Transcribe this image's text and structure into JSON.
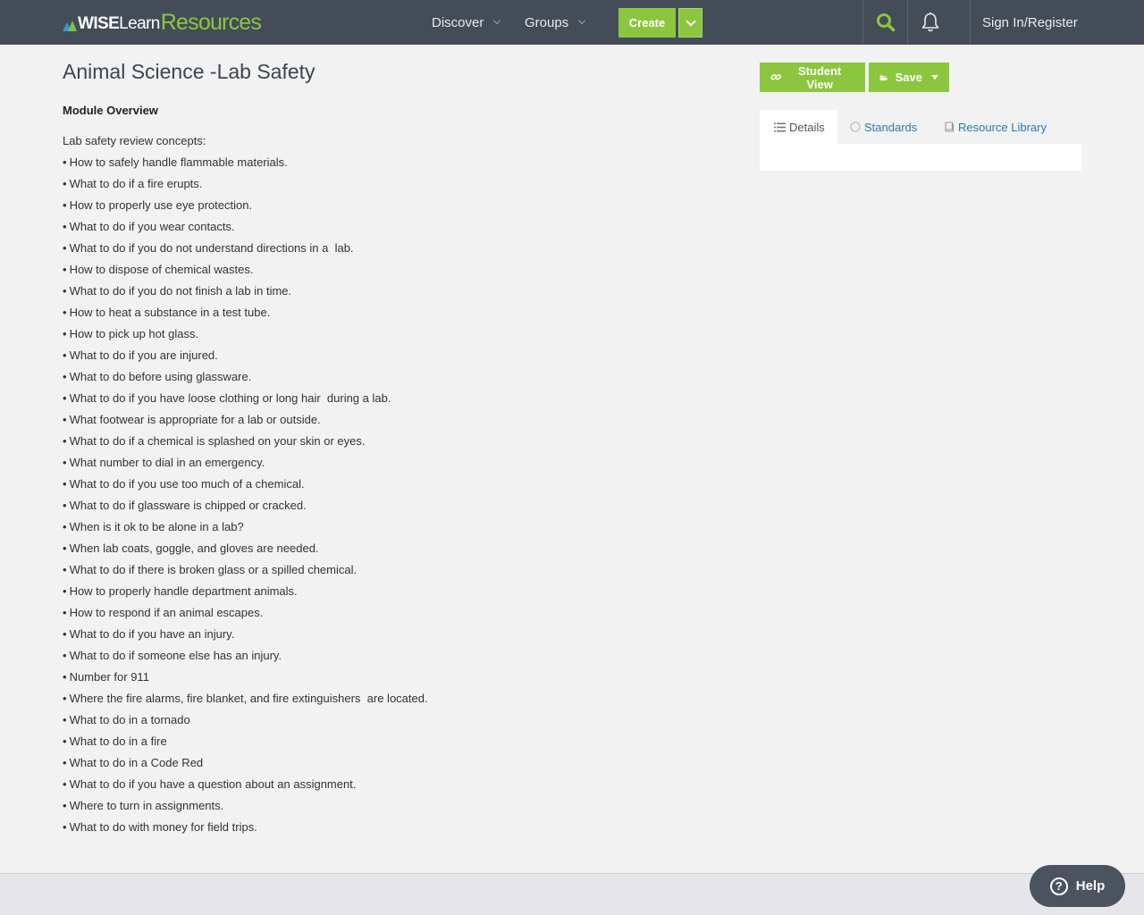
{
  "header": {
    "logo": {
      "wise": "WISE",
      "learn": "Learn",
      "resources": "Resources"
    },
    "nav": [
      {
        "label": "Discover"
      },
      {
        "label": "Groups"
      }
    ],
    "create_label": "Create",
    "signin_label": "Sign In/Register",
    "icons": {
      "search": "search-icon",
      "notifications": "bell-icon",
      "create_menu": "chevron-down-icon"
    },
    "colors": {
      "bar": "#444c58",
      "accent": "#8cc63f",
      "brand_blue": "#2f9ad6"
    }
  },
  "main": {
    "title": "Animal Science -Lab Safety",
    "overview_heading": "Module Overview",
    "intro": "Lab safety review concepts:",
    "bullet": "•",
    "items": [
      "How to safely handle flammable materials.",
      "What to do if a fire erupts.",
      "How to properly use eye protection.",
      "What to do if you wear contacts.",
      "What to do if you do not understand directions in a  lab.",
      "How to dispose of chemical wastes.",
      "What to do if you do not finish a lab in time.",
      "How to heat a substance in a test tube.",
      "How to pick up hot glass.",
      "What to do if you are injured.",
      "What to do before using glassware.",
      "What to do if you have loose clothing or long hair  during a lab.",
      "What footwear is appropriate for a lab or outside.",
      "What to do if a chemical is splashed on your skin or eyes.",
      "What number to dial in an emergency.",
      "What to do if you use too much of a chemical.",
      "What to do if glassware is chipped or cracked.",
      "When is it ok to be alone in a lab?",
      "When lab coats, goggle, and gloves are needed.",
      "What to do if there is broken glass or a spilled chemical.",
      "How to properly handle department animals.",
      "How to respond if an animal escapes.",
      "What to do if you have an injury.",
      "What to do if someone else has an injury.",
      "Number for 911",
      "Where the fire alarms, fire blanket, and fire extinguishers  are located.",
      "What to do in a tornado",
      "What to do in a fire",
      "What to do in a Code Red",
      "What to do if you have a question about an assignment.",
      "Where to turn in assignments.",
      "What to do with money for field trips."
    ]
  },
  "sidebar": {
    "student_view_label": "Student View",
    "save_label": "Save",
    "tabs": [
      {
        "label": "Details",
        "icon": "list-icon",
        "active": true
      },
      {
        "label": "Standards",
        "icon": "circle-icon",
        "active": false
      },
      {
        "label": "Resource Library",
        "icon": "book-icon",
        "active": false
      }
    ]
  },
  "help": {
    "label": "Help",
    "icon": "question-circle-icon"
  }
}
